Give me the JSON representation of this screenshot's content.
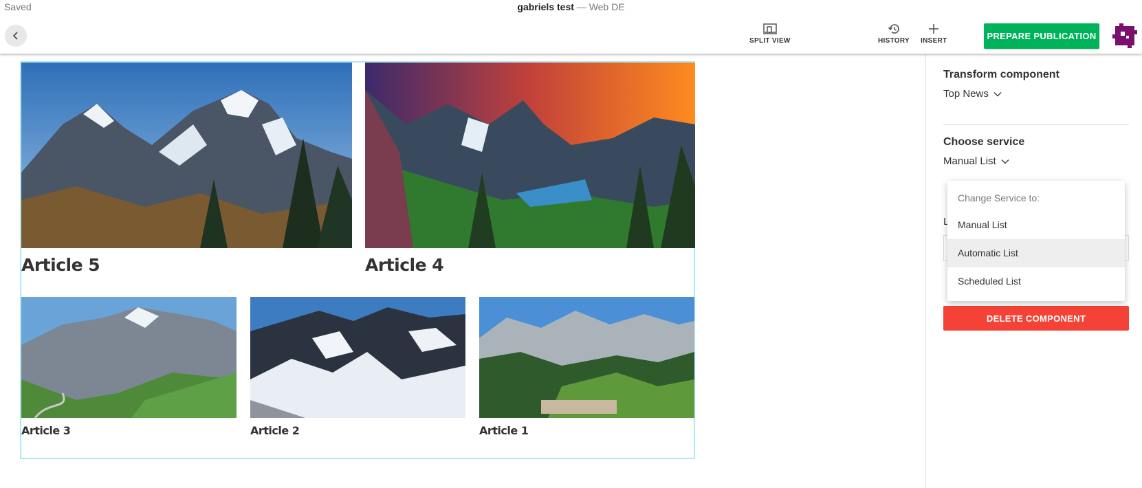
{
  "status": {
    "saved_label": "Saved"
  },
  "document": {
    "name": "gabriels test",
    "separator": " — ",
    "channel": "Web DE"
  },
  "toolbar": {
    "back_icon": "chevron-left-icon",
    "split_view_label": "SPLIT VIEW",
    "history_label": "HISTORY",
    "insert_label": "INSERT",
    "publish_label": "PREPARE PUBLICATION",
    "publish_color": "#00b35a"
  },
  "articles": [
    {
      "title": "Article 5",
      "image": "mountain-glacier-photo"
    },
    {
      "title": "Article 4",
      "image": "sunset-valley-photo"
    },
    {
      "title": "Article 3",
      "image": "mountain-pass-photo"
    },
    {
      "title": "Article 2",
      "image": "glacier-peaks-photo"
    },
    {
      "title": "Article 1",
      "image": "alpine-village-photo"
    }
  ],
  "panel": {
    "transform_heading": "Transform component",
    "transform_value": "Top News",
    "service_heading": "Choose service",
    "service_value": "Manual List",
    "hidden_label": "L",
    "delete_label": "DELETE COMPONENT",
    "delete_color": "#f44336"
  },
  "dropdown": {
    "header": "Change Service to:",
    "options": [
      "Manual List",
      "Automatic List",
      "Scheduled List"
    ],
    "hovered": "Automatic List"
  }
}
